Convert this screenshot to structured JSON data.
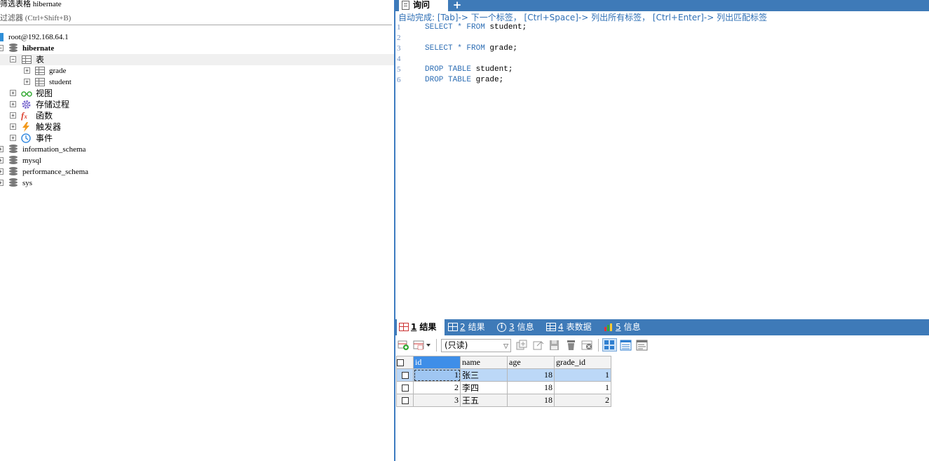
{
  "left_panel": {
    "filter_title": "筛选表格 hibernate",
    "filter_placeholder": "过滤器 (Ctrl+Shift+B)",
    "tree": {
      "connection": "root@192.168.64.1",
      "db_hibernate": "hibernate",
      "tables_folder": "表",
      "tables": [
        "grade",
        "student"
      ],
      "views": "视图",
      "procedures": "存储过程",
      "functions": "函数",
      "triggers": "触发器",
      "events": "事件",
      "other_dbs": [
        "information_schema",
        "mysql",
        "performance_schema",
        "sys"
      ]
    }
  },
  "query_editor": {
    "tab_label": "询问",
    "add_tab": "+",
    "autocomplete_hint": "自动完成: [Tab]-> 下一个标签， [Ctrl+Space]-> 列出所有标签， [Ctrl+Enter]-> 列出匹配标签",
    "lines": [
      {
        "n": "1",
        "kw1": "SELECT * FROM",
        "rest": " student;"
      },
      {
        "n": "2",
        "kw1": "",
        "rest": ""
      },
      {
        "n": "3",
        "kw1": "SELECT * FROM",
        "rest": " grade;"
      },
      {
        "n": "4",
        "kw1": "",
        "rest": ""
      },
      {
        "n": "5",
        "kw1": "DROP TABLE",
        "rest": " student;"
      },
      {
        "n": "6",
        "kw1": "DROP TABLE",
        "rest": " grade;"
      }
    ]
  },
  "result_panel": {
    "tabs": [
      {
        "num": "1",
        "label": "结果"
      },
      {
        "num": "2",
        "label": "结果"
      },
      {
        "num": "3",
        "label": "信息"
      },
      {
        "num": "4",
        "label": "表数据"
      },
      {
        "num": "5",
        "label": "信息"
      }
    ],
    "readonly_select": "(只读)",
    "columns": [
      "id",
      "name",
      "age",
      "grade_id"
    ],
    "rows": [
      [
        "1",
        "张三",
        "18",
        "1"
      ],
      [
        "2",
        "李四",
        "18",
        "1"
      ],
      [
        "3",
        "王五",
        "18",
        "2"
      ]
    ]
  },
  "colors": {
    "accent": "#3e7ab8",
    "keyword": "#2f6fb5",
    "selected_row": "#bcd8f7",
    "header_active": "#3e8ee8"
  }
}
